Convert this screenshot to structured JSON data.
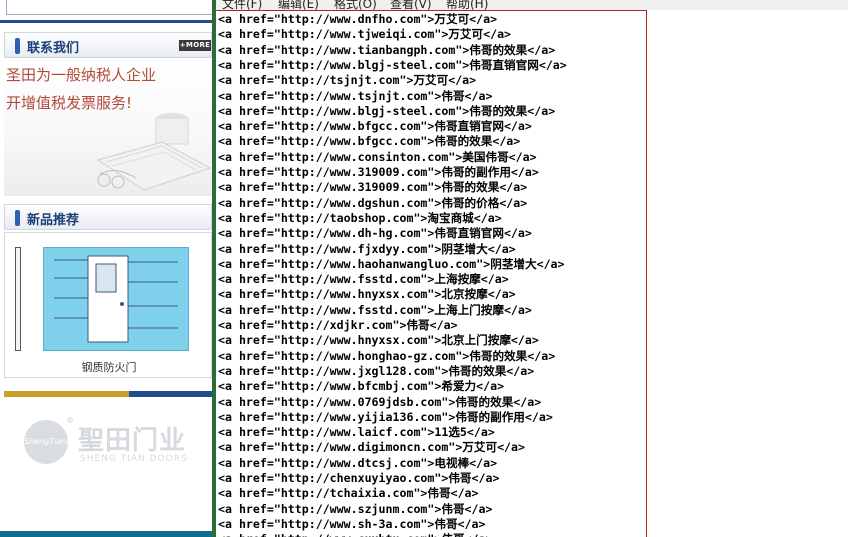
{
  "website": {
    "contact_title": "联系我们",
    "more_label": "+MORE",
    "contact_lines": [
      "圣田为一般纳税人企业",
      "开增值税发票服务!"
    ],
    "products_title": "新品推荐",
    "product_caption": "钢质防火门",
    "logo_mark": "ShengTianMen",
    "logo_cn": "聖田门业",
    "logo_en": "SHENG TIAN DOORS"
  },
  "source_window": {
    "menu": [
      "文件(F)",
      "编辑(E)",
      "格式(O)",
      "查看(V)",
      "帮助(H)"
    ],
    "lines": [
      "<a href=\"http://www.dnfho.com\">万艾可</a>",
      "<a href=\"http://www.tjweiqi.com\">万艾可</a>",
      "<a href=\"http://www.tianbangph.com\">伟哥的效果</a>",
      "<a href=\"http://www.blgj-steel.com\">伟哥直销官网</a>",
      "<a href=\"http://tsjnjt.com\">万艾可</a>",
      "<a href=\"http://www.tsjnjt.com\">伟哥</a>",
      "<a href=\"http://www.blgj-steel.com\">伟哥的效果</a>",
      "<a href=\"http://www.bfgcc.com\">伟哥直销官网</a>",
      "<a href=\"http://www.bfgcc.com\">伟哥的效果</a>",
      "<a href=\"http://www.consinton.com\">美国伟哥</a>",
      "<a href=\"http://www.319009.com\">伟哥的副作用</a>",
      "<a href=\"http://www.319009.com\">伟哥的效果</a>",
      "<a href=\"http://www.dgshun.com\">伟哥的价格</a>",
      "<a href=\"http://taobshop.com\">淘宝商城</a>",
      "<a href=\"http://www.dh-hg.com\">伟哥直销官网</a>",
      "<a href=\"http://www.fjxdyy.com\">阴茎增大</a>",
      "<a href=\"http://www.haohanwangluo.com\">阴茎增大</a>",
      "<a href=\"http://www.fsstd.com\">上海按摩</a>",
      "<a href=\"http://www.hnyxsx.com\">北京按摩</a>",
      "<a href=\"http://www.fsstd.com\">上海上门按摩</a>",
      "<a href=\"http://xdjkr.com\">伟哥</a>",
      "<a href=\"http://www.hnyxsx.com\">北京上门按摩</a>",
      "<a href=\"http://www.honghao-gz.com\">伟哥的效果</a>",
      "<a href=\"http://www.jxgl128.com\">伟哥的效果</a>",
      "<a href=\"http://www.bfcmbj.com\">希爱力</a>",
      "<a href=\"http://www.0769jdsb.com\">伟哥的效果</a>",
      "<a href=\"http://www.yijia136.com\">伟哥的副作用</a>",
      "<a href=\"http://www.laicf.com\">11选5</a>",
      "<a href=\"http://www.digimoncn.com\">万艾可</a>",
      "<a href=\"http://www.dtcsj.com\">电视棒</a>",
      "<a href=\"http://chenxuyiyao.com\">伟哥</a>",
      "<a href=\"http://tchaixia.com\">伟哥</a>",
      "<a href=\"http://www.szjunm.com\">伟哥</a>",
      "<a href=\"http://www.sh-3a.com\">伟哥</a>",
      "<a href=\"http://www.cuxbtu.com\">伟哥</a>"
    ]
  },
  "colors": {
    "accent_blue": "#1f4e8c",
    "pane_border": "#b22222",
    "window_frame": "#2f6b3a"
  }
}
